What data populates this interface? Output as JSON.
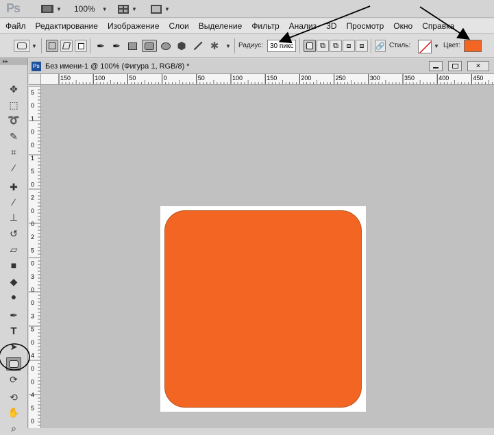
{
  "app": {
    "logo": "Ps",
    "zoom": "100%"
  },
  "menu": [
    "Файл",
    "Редактирование",
    "Изображение",
    "Слои",
    "Выделение",
    "Фильтр",
    "Анализ",
    "3D",
    "Просмотр",
    "Окно",
    "Справка"
  ],
  "options": {
    "radius_label": "Радиус:",
    "radius_value": "30 пикс",
    "style_label": "Стиль:",
    "color_label": "Цвет:",
    "color_value": "#f26522"
  },
  "document": {
    "title": "Без имени-1 @ 100% (Фигура 1, RGB/8) *",
    "shape_color": "#f26522",
    "ruler_top_labels": [
      "150",
      "100",
      "50",
      "0",
      "50",
      "100",
      "150",
      "200",
      "250",
      "300",
      "350",
      "400",
      "450"
    ],
    "ruler_left_labels": [
      "5",
      "0",
      "1",
      "0",
      "0",
      "1",
      "5",
      "0",
      "2",
      "0",
      "0",
      "2",
      "5",
      "0",
      "3",
      "0",
      "0",
      "3",
      "5",
      "0",
      "4",
      "0",
      "0",
      "4",
      "5",
      "0"
    ]
  },
  "colors": {
    "accent": "#f26522",
    "ps_blue": "#1d4f9a"
  },
  "icons": {
    "tools": [
      "move-icon",
      "marquee-icon",
      "lasso-icon",
      "quick-select-icon",
      "crop-icon",
      "eyedropper-icon",
      "healing-icon",
      "brush-icon",
      "stamp-icon",
      "history-brush-icon",
      "eraser-icon",
      "gradient-icon",
      "blur-icon",
      "dodge-icon",
      "pen-icon",
      "type-icon",
      "path-select-icon",
      "rounded-rectangle-icon",
      "3d-rotate-icon",
      "3d-orbit-icon",
      "hand-icon",
      "zoom-icon"
    ]
  }
}
